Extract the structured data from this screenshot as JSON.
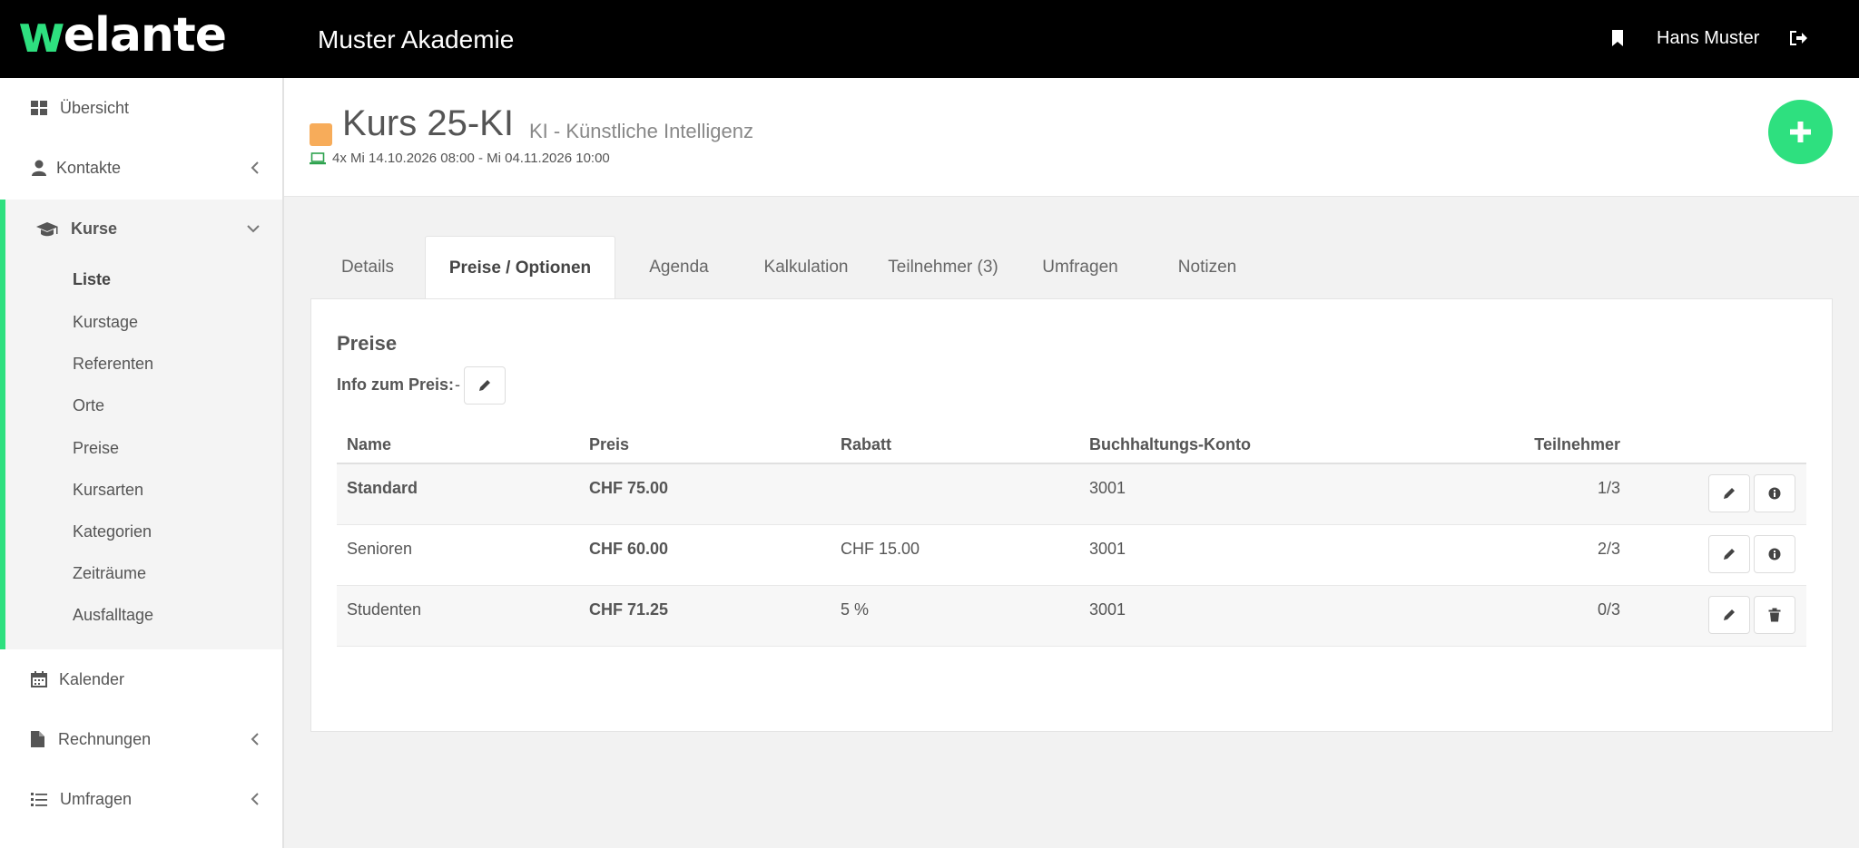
{
  "topbar": {
    "logo_w": "w",
    "logo_rest": "elante",
    "org_title": "Muster Akademie",
    "user_name": "Hans Muster",
    "bookmark_icon": "bookmark-icon",
    "logout_icon": "sign-out-icon"
  },
  "sidebar": {
    "items": [
      {
        "label": "Übersicht",
        "icon": "dashboard-icon"
      },
      {
        "label": "Kontakte",
        "icon": "user-icon"
      },
      {
        "label": "Kurse",
        "icon": "graduation-cap-icon"
      },
      {
        "label": "Kalender",
        "icon": "calendar-icon"
      },
      {
        "label": "Rechnungen",
        "icon": "file-icon"
      },
      {
        "label": "Umfragen",
        "icon": "list-icon"
      }
    ],
    "kurse_sub": [
      "Liste",
      "Kurstage",
      "Referenten",
      "Orte",
      "Preise",
      "Kursarten",
      "Kategorien",
      "Zeiträume",
      "Ausfalltage"
    ],
    "active_sub": "Liste"
  },
  "course": {
    "title": "Kurs 25-KI",
    "subtitle": "KI - Künstliche Intelligenz",
    "dates": "4x Mi 14.10.2026 08:00 - Mi 04.11.2026 10:00",
    "color": "#f7ac5a"
  },
  "tabs": [
    {
      "label": "Details"
    },
    {
      "label": "Preise / Optionen",
      "active": true
    },
    {
      "label": "Agenda"
    },
    {
      "label": "Kalkulation"
    },
    {
      "label": "Teilnehmer (3)"
    },
    {
      "label": "Umfragen"
    },
    {
      "label": "Notizen"
    }
  ],
  "prices": {
    "section_title": "Preise",
    "info_label": "Info zum Preis:",
    "info_value": "-",
    "columns": {
      "name": "Name",
      "preis": "Preis",
      "rabatt": "Rabatt",
      "konto": "Buchhaltungs-Konto",
      "teilnehmer": "Teilnehmer"
    },
    "rows": [
      {
        "name": "Standard",
        "preis": "CHF 75.00",
        "rabatt": "",
        "konto": "3001",
        "teilnehmer": "1/3",
        "actions": [
          "pencil-icon",
          "info-icon"
        ]
      },
      {
        "name": "Senioren",
        "preis": "CHF 60.00",
        "rabatt": "CHF 15.00",
        "konto": "3001",
        "teilnehmer": "2/3",
        "actions": [
          "pencil-icon",
          "info-icon"
        ]
      },
      {
        "name": "Studenten",
        "preis": "CHF 71.25",
        "rabatt": "5 %",
        "konto": "3001",
        "teilnehmer": "0/3",
        "actions": [
          "pencil-icon",
          "trash-icon"
        ]
      }
    ]
  },
  "colors": {
    "accent": "#2ee07f",
    "topbar": "#000000"
  }
}
